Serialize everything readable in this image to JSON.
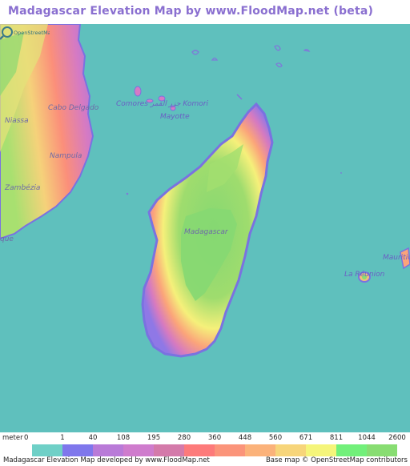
{
  "title": "Madagascar Elevation Map by www.FloodMap.net (beta)",
  "map": {
    "sea_color": "#5fc0bd",
    "labels": {
      "comores": "Comores جزر القمر Komori",
      "mayotte": "Mayotte",
      "cabo_delgado": "Cabo Delgado",
      "niassa": "Niassa",
      "nampula": "Nampula",
      "zambezia": "Zambézia",
      "que": "que",
      "madagascar": "Madagascar",
      "la_reunion": "La Réunion",
      "mauritius": "Mauritius"
    },
    "osm_logo": "OpenStreetMap"
  },
  "legend": {
    "unit": "meter",
    "ticks": [
      "0",
      "1",
      "40",
      "108",
      "195",
      "280",
      "360",
      "448",
      "560",
      "671",
      "811",
      "1044",
      "2600"
    ],
    "colors": [
      "#6fd0c7",
      "#7f77ec",
      "#b97ad8",
      "#cf7ccd",
      "#d47aaa",
      "#fd7a7a",
      "#fb947a",
      "#fbb27a",
      "#f7d57a",
      "#f5f57a",
      "#72f07a",
      "#88dd72"
    ]
  },
  "footer": {
    "left": "Madagascar Elevation Map developed by www.FloodMap.net",
    "right": "Base map © OpenStreetMap contributors"
  }
}
